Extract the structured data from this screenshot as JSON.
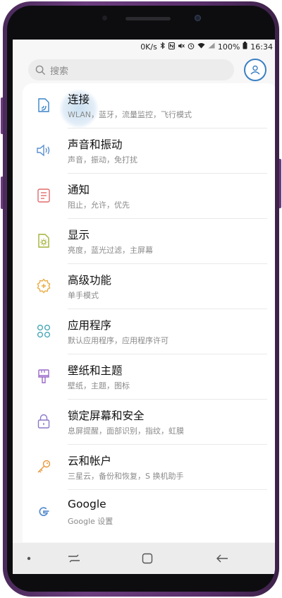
{
  "status_bar": {
    "speed": "0K/s",
    "battery_percent": "100%",
    "time": "16:34"
  },
  "search": {
    "placeholder": "搜索"
  },
  "colors": {
    "accent": "#3a7fc4",
    "frame": "#6d3e80"
  },
  "settings": [
    {
      "title": "连接",
      "subtitle": "WLAN，蓝牙，流量监控，飞行模式",
      "icon": "connections-icon"
    },
    {
      "title": "声音和振动",
      "subtitle": "声音，振动，免打扰",
      "icon": "speaker-icon"
    },
    {
      "title": "通知",
      "subtitle": "阻止，允许，优先",
      "icon": "notification-icon"
    },
    {
      "title": "显示",
      "subtitle": "亮度，蓝光过滤，主屏幕",
      "icon": "display-icon"
    },
    {
      "title": "高级功能",
      "subtitle": "单手模式",
      "icon": "gear-plus-icon"
    },
    {
      "title": "应用程序",
      "subtitle": "默认应用程序，应用程序许可",
      "icon": "apps-grid-icon"
    },
    {
      "title": "壁纸和主题",
      "subtitle": "壁纸，主题，图标",
      "icon": "paintbrush-icon"
    },
    {
      "title": "锁定屏幕和安全",
      "subtitle": "息屏提醒，面部识别，指纹，虹膜",
      "icon": "lock-icon"
    },
    {
      "title": "云和帐户",
      "subtitle": "三星云，备份和恢复，S 换机助手",
      "icon": "key-icon"
    },
    {
      "title": "Google",
      "subtitle": "Google 设置",
      "icon": "google-icon"
    }
  ]
}
